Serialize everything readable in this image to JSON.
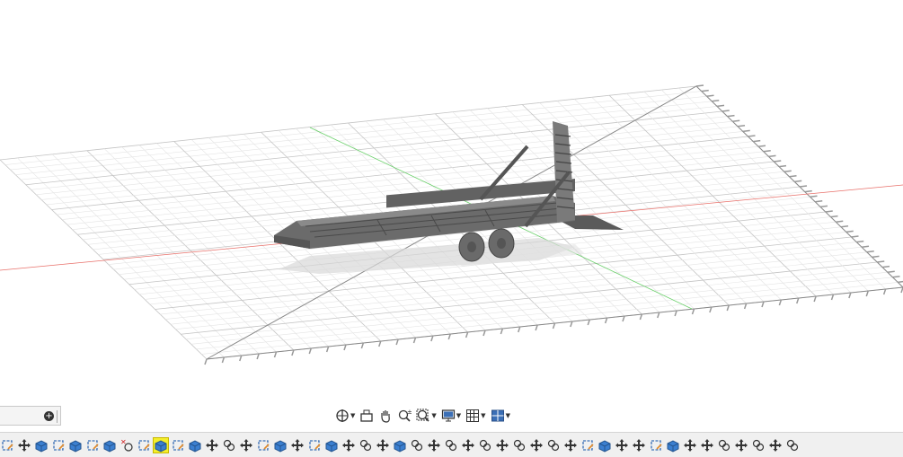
{
  "app": {
    "name": "3D CAD viewport"
  },
  "browser_stub": {
    "add_icon": "plus-circle-icon"
  },
  "nav_toolbar": {
    "buttons": [
      {
        "name": "orbit-button",
        "icon": "orbit-icon",
        "dropdown": true
      },
      {
        "name": "look-at-button",
        "icon": "look-at-icon",
        "dropdown": false
      },
      {
        "name": "pan-button",
        "icon": "hand-icon",
        "dropdown": false
      },
      {
        "name": "zoom-button",
        "icon": "zoom-icon",
        "dropdown": false
      },
      {
        "name": "fit-button",
        "icon": "zoom-window-icon",
        "dropdown": true
      },
      {
        "name": "display-settings-button",
        "icon": "display-icon",
        "dropdown": true
      },
      {
        "name": "grid-snaps-button",
        "icon": "grid-icon",
        "dropdown": true
      },
      {
        "name": "viewports-button",
        "icon": "viewports-icon",
        "dropdown": true
      }
    ]
  },
  "timeline": {
    "items": [
      "sketch",
      "move",
      "body",
      "sketch",
      "body",
      "sketch",
      "body",
      "cut",
      "sketch",
      "body-active",
      "sketch",
      "body",
      "move",
      "join",
      "move",
      "sketch",
      "body",
      "move",
      "sketch",
      "body",
      "move",
      "join",
      "move",
      "body",
      "join",
      "move",
      "join",
      "move",
      "join",
      "move",
      "join",
      "move",
      "join",
      "move",
      "sketch",
      "body",
      "move",
      "move",
      "sketch",
      "body",
      "move",
      "move",
      "join",
      "move",
      "join",
      "move",
      "join"
    ],
    "active_index": 9
  },
  "colors": {
    "x_axis": "#e8706a",
    "y_axis": "#6ad06a",
    "model": "#6b6b6b",
    "active_highlight": "#f4ee2a"
  }
}
